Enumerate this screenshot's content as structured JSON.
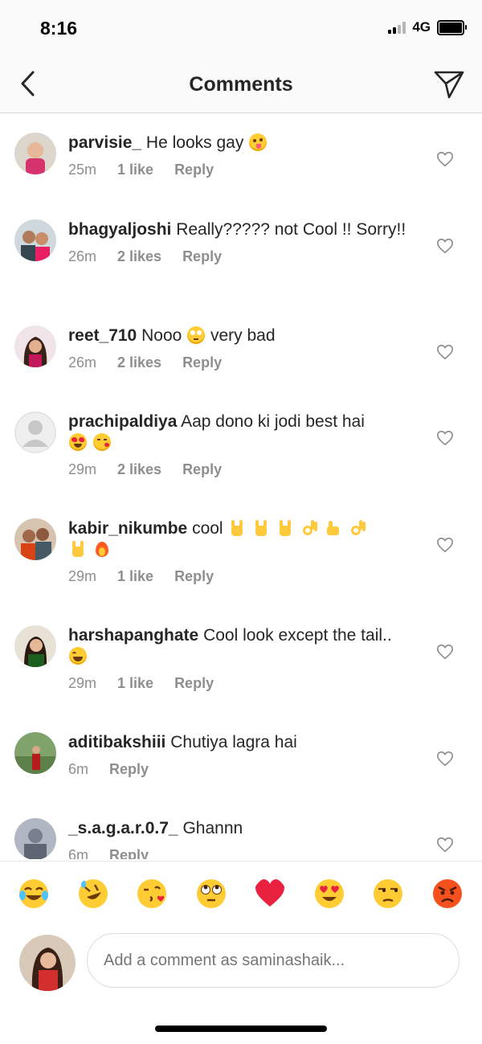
{
  "status_bar": {
    "time": "8:16",
    "network": "4G"
  },
  "header": {
    "title": "Comments"
  },
  "comments": [
    {
      "username": "parvisie_",
      "text": "He looks gay",
      "emojis": [
        "zany-face"
      ],
      "time": "25m",
      "likes": "1 like",
      "reply": "Reply"
    },
    {
      "username": "bhagyaljoshi",
      "text": "Really????? not Cool !! Sorry!!",
      "emojis": [],
      "time": "26m",
      "likes": "2 likes",
      "reply": "Reply"
    },
    {
      "username": "reet_710",
      "text": "Nooo",
      "text_after": "very bad",
      "emojis": [
        "face-with-rolling-eyes"
      ],
      "time": "26m",
      "likes": "2 likes",
      "reply": "Reply"
    },
    {
      "username": "prachipaldiya",
      "text": "Aap dono ki jodi best hai",
      "emojis": [
        "heart-eyes-face",
        "face-blowing-kiss"
      ],
      "time": "29m",
      "likes": "2 likes",
      "reply": "Reply"
    },
    {
      "username": "kabir_nikumbe",
      "text": "cool",
      "emojis": [
        "sign-of-horns",
        "sign-of-horns",
        "sign-of-horns",
        "ok-hand",
        "thumbs-up",
        "ok-hand",
        "sign-of-horns",
        "fire"
      ],
      "time": "29m",
      "likes": "1 like",
      "reply": "Reply"
    },
    {
      "username": "harshapanghate",
      "text": "Cool look except the tail..",
      "emojis": [
        "face-with-tears-of-joy"
      ],
      "time": "29m",
      "likes": "1 like",
      "reply": "Reply"
    },
    {
      "username": "aditibakshiii",
      "text": "Chutiya lagra hai",
      "emojis": [],
      "time": "6m",
      "likes": "",
      "reply": "Reply"
    },
    {
      "username": "_s.a.g.a.r.0.7_",
      "text": "Ghannn",
      "emojis": [],
      "time": "6m",
      "likes": "",
      "reply": "Reply"
    }
  ],
  "quick_reactions": [
    "face-with-tears-of-joy",
    "rolling-on-floor-laughing",
    "face-blowing-kiss",
    "face-with-rolling-eyes",
    "red-heart",
    "heart-eyes-face",
    "unamused-face",
    "pouting-face"
  ],
  "composer": {
    "placeholder": "Add a comment as saminashaik..."
  },
  "colors": {
    "text": "#262626",
    "meta": "#8e8e8e",
    "divider": "#dbdbdb",
    "heart_red": "#e8213e",
    "emoji_yellow": "#ffcc33"
  }
}
